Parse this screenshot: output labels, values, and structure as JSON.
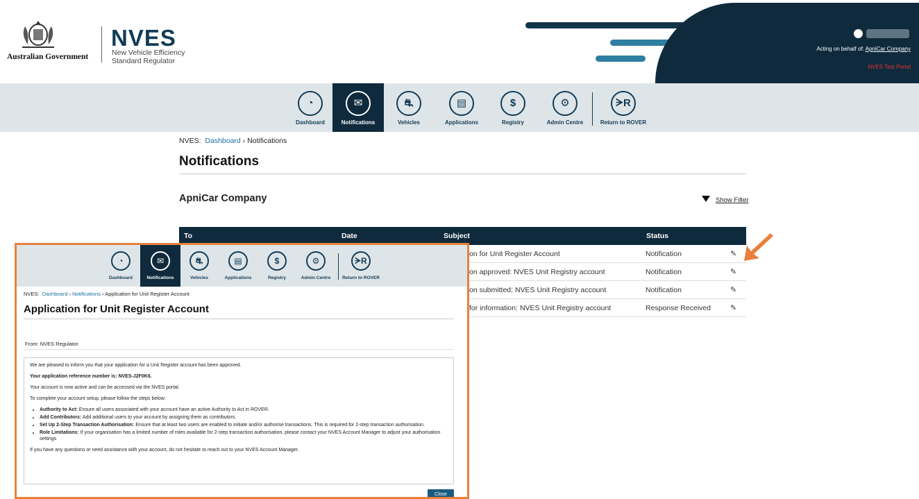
{
  "header": {
    "gov_text": "Australian Government",
    "logo_text": "NVES",
    "logo_subtitle_line1": "New Vehicle Efficiency",
    "logo_subtitle_line2": "Standard Regulator",
    "acting_label": "Acting on behalf of:",
    "acting_company": "ApniCar Company",
    "portal_label": "NVES Test Portal",
    "colors": {
      "dark": "#0f2a3c",
      "accent": "#2e7ea1",
      "portal": "#e03333"
    }
  },
  "nav": {
    "items": [
      {
        "label": "Dashboard",
        "icon": "speedometer-icon",
        "glyph": "◔",
        "active": false
      },
      {
        "label": "Notifications",
        "icon": "envelope-icon",
        "glyph": "✉",
        "active": true
      },
      {
        "label": "Vehicles",
        "icon": "car-leaf-icon",
        "glyph": "⛐",
        "active": false
      },
      {
        "label": "Applications",
        "icon": "document-icon",
        "glyph": "▤",
        "active": false
      },
      {
        "label": "Registry",
        "icon": "dollar-exchange-icon",
        "glyph": "$",
        "active": false
      },
      {
        "label": "Admin Centre",
        "icon": "gear-icon",
        "glyph": "⚙",
        "active": false
      },
      {
        "label": "Return to ROVER",
        "icon": "rover-icon",
        "glyph": "ᗒR",
        "active": false
      }
    ]
  },
  "breadcrumb": {
    "prefix": "NVES:",
    "link": "Dashboard",
    "separator": "›",
    "current": "Notifications"
  },
  "page_title": "Notifications",
  "company_name": "ApniCar Company",
  "filter_label": "Show Filter",
  "table": {
    "columns": [
      "To",
      "Date",
      "Subject",
      "Status"
    ],
    "rows": [
      {
        "subject": "on for Unit Register Account",
        "status": "Notification"
      },
      {
        "subject": "on approved: NVES Unit Registry account",
        "status": "Notification"
      },
      {
        "subject": "on submitted: NVES Unit Registry account",
        "status": "Notification"
      },
      {
        "subject": "for information: NVES Unit Registry account",
        "status": "Response Received"
      }
    ],
    "edit_glyph": "✎"
  },
  "modal": {
    "breadcrumb": {
      "prefix": "NVES:",
      "link1": "Dashboard",
      "link2": "Notifications",
      "separator": "›",
      "current": "Application for Unit Register Account"
    },
    "title": "Application for Unit Register Account",
    "from": "From: NVES Regulator",
    "body": {
      "p1": "We are pleased to inform you that your application for a Unit Register account has been approved.",
      "p2": "Your application reference number is: NVES-J2F0K6.",
      "p3": "Your account is now active and can be accessed via the NVES portal.",
      "p4": "To complete your account setup, please follow the steps below:",
      "bullets": [
        {
          "bold": "Authority to Act:",
          "text": " Ensure all users associated with your account have an active Authority to Act in ROVER."
        },
        {
          "bold": "Add Contributors:",
          "text": " Add additional users to your account by assigning them as contributors."
        },
        {
          "bold": "Set Up 2-Step Transaction Authorisation:",
          "text": " Ensure that at least two users are enabled to initiate and/or authorise transactions. This is required for 2-step transaction authorisation."
        },
        {
          "bold": "Role Limitations:",
          "text": " If your organisation has a limited number of roles available for 2-step transaction authorisation, please contact your NVES Account Manager to adjust your authorisation settings"
        }
      ],
      "p5": "If you have any questions or need assistance with your account, do not hesitate to reach out to your NVES Account Manager."
    },
    "close_label": "Close",
    "border_color": "#e8813c"
  }
}
